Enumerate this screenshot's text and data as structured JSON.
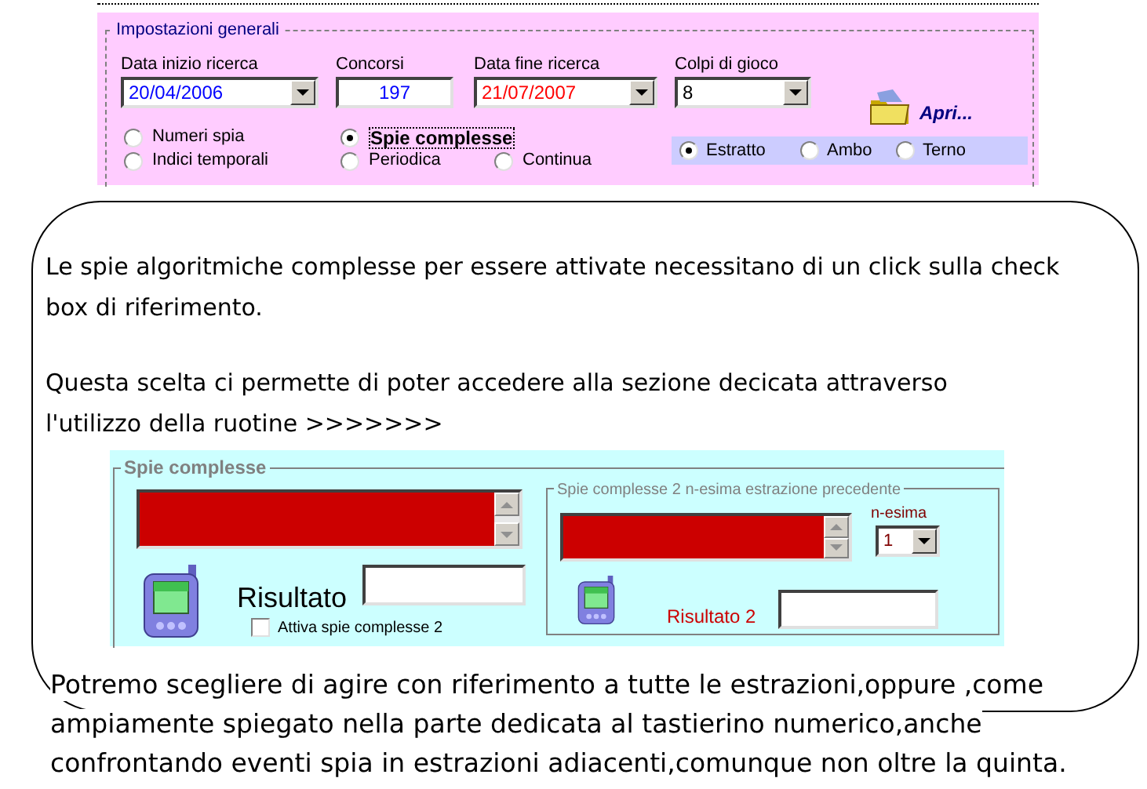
{
  "settings_panel": {
    "title": "Impostazioni generali",
    "fields": [
      {
        "label": "Data inizio ricerca",
        "value": "20/04/2006",
        "kind": "dropdown",
        "color": "#0000ff"
      },
      {
        "label": "Concorsi",
        "value": "197",
        "kind": "textbox",
        "color": "#0000ff"
      },
      {
        "label": "Data fine ricerca",
        "value": "21/07/2007",
        "kind": "dropdown",
        "color": "#ff0000"
      },
      {
        "label": "Colpi di gioco",
        "value": "8",
        "kind": "dropdown",
        "color": "#000000"
      }
    ],
    "modes": [
      {
        "label": "Numeri spia",
        "selected": false
      },
      {
        "label": "Indici temporali",
        "selected": false
      },
      {
        "label": "Spie complesse",
        "selected": true
      },
      {
        "label": "Periodica",
        "selected": false
      },
      {
        "label": "Continua",
        "selected": false
      }
    ],
    "open_button": {
      "label": "Apri..."
    },
    "play_options": [
      {
        "label": "Estratto",
        "selected": true
      },
      {
        "label": "Ambo",
        "selected": false
      },
      {
        "label": "Terno",
        "selected": false
      }
    ]
  },
  "bubble": {
    "paragraphs": [
      [
        "Le spie algoritmiche complesse per essere attivate necessitano di un click sulla check",
        "box di riferimento."
      ],
      [
        "Questa scelta ci permette di poter accedere alla sezione decicata attraverso",
        "l'utilizzo della ruotine  >>>>>>>"
      ]
    ]
  },
  "spie_panel": {
    "title": "Spie complesse",
    "result_label": "Risultato",
    "checkbox": {
      "label": "Attiva spie complesse 2",
      "checked": false
    },
    "group2": {
      "title": "Spie complesse 2 n-esima estrazione precedente",
      "nth_label": "n-esima",
      "nth_value": "1",
      "result_label": "Risultato 2"
    }
  },
  "caption": [
    "Potremo scegliere di agire con riferimento a tutte le estrazioni,oppure ,come",
    "ampiamente spiegato nella parte dedicata al tastierino numerico,anche",
    "confrontando eventi spia in estrazioni adiacenti,comunque non oltre la quinta."
  ]
}
